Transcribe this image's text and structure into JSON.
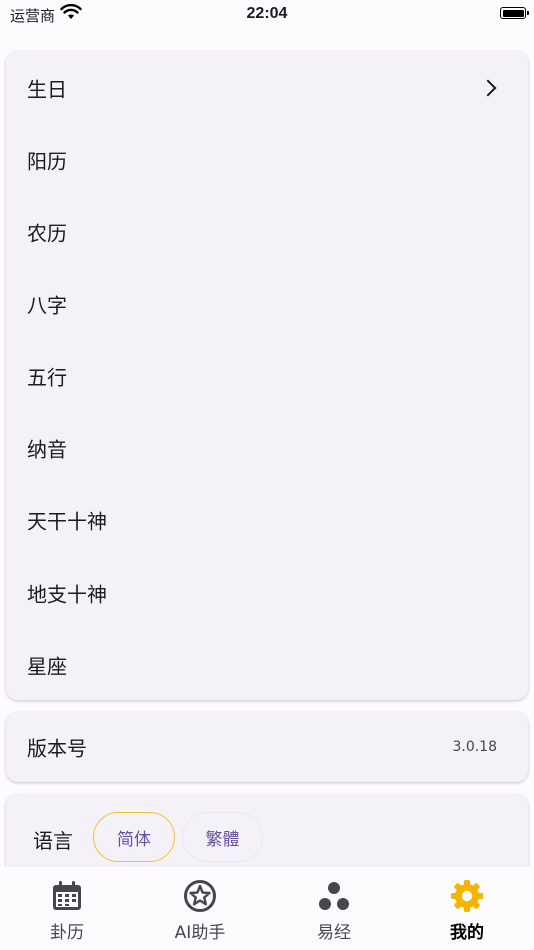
{
  "status_bar": {
    "carrier": "运营商",
    "time": "22:04"
  },
  "info_card": {
    "rows": [
      {
        "label": "生日"
      },
      {
        "label": "阳历"
      },
      {
        "label": "农历"
      },
      {
        "label": "八字"
      },
      {
        "label": "五行"
      },
      {
        "label": "纳音"
      },
      {
        "label": "天干十神"
      },
      {
        "label": "地支十神"
      },
      {
        "label": "星座"
      }
    ]
  },
  "version_card": {
    "label": "版本号",
    "value": "3.0.18"
  },
  "language_card": {
    "label": "语言",
    "options": [
      "简体",
      "繁體"
    ],
    "selected": "简体"
  },
  "bottom_nav": {
    "items": [
      {
        "label": "卦历",
        "icon": "calendar-icon"
      },
      {
        "label": "AI助手",
        "icon": "star-badge-icon"
      },
      {
        "label": "易经",
        "icon": "three-dots-icon"
      },
      {
        "label": "我的",
        "icon": "gear-icon"
      }
    ],
    "active_index": 3,
    "active_color": "#f5b400",
    "inactive_color": "#49454f"
  },
  "colors": {
    "accent": "#6750a4",
    "selected_border": "#f2c230",
    "card_bg": "#f5f1f8"
  }
}
